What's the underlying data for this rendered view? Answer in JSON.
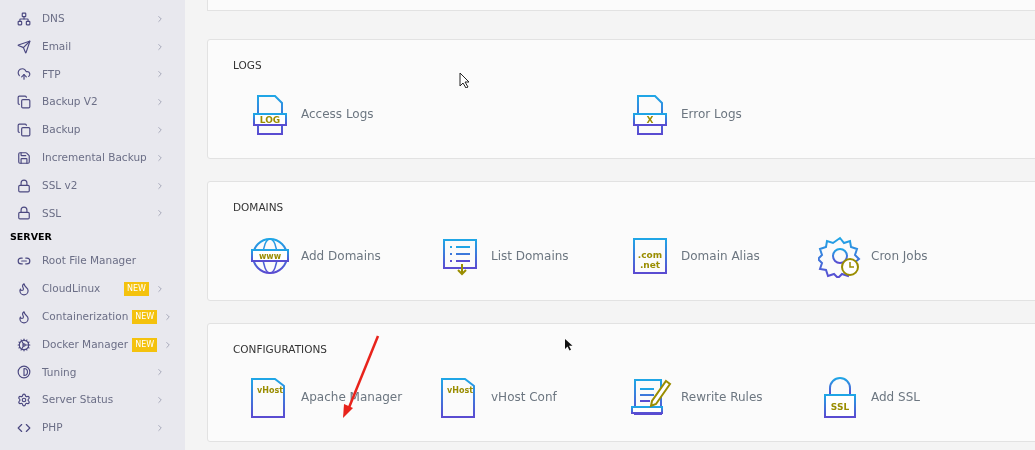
{
  "sidebar": {
    "items": [
      {
        "label": "DNS"
      },
      {
        "label": "Email"
      },
      {
        "label": "FTP"
      },
      {
        "label": "Backup V2"
      },
      {
        "label": "Backup"
      },
      {
        "label": "Incremental Backup"
      },
      {
        "label": "SSL v2"
      },
      {
        "label": "SSL"
      }
    ],
    "section": "SERVER",
    "server_items": [
      {
        "label": "Root File Manager",
        "chevron": false
      },
      {
        "label": "CloudLinux",
        "badge": "NEW",
        "chevron": true
      },
      {
        "label": "Containerization",
        "badge": "NEW",
        "chevron": true
      },
      {
        "label": "Docker Manager",
        "badge": "NEW",
        "chevron": true
      },
      {
        "label": "Tuning",
        "chevron": true
      },
      {
        "label": "Server Status",
        "chevron": true
      },
      {
        "label": "PHP",
        "chevron": true
      }
    ]
  },
  "sections": [
    {
      "title": "LOGS",
      "items": [
        {
          "label": "Access Logs",
          "icon_text": "LOG"
        },
        {
          "label": "Error Logs",
          "icon_text": "X"
        }
      ]
    },
    {
      "title": "DOMAINS",
      "items": [
        {
          "label": "Add Domains",
          "icon_text": "www"
        },
        {
          "label": "List Domains"
        },
        {
          "label": "Domain Alias",
          "icon_text": ".com",
          "icon_text_2": ".net"
        },
        {
          "label": "Cron Jobs"
        }
      ]
    },
    {
      "title": "CONFIGURATIONS",
      "items": [
        {
          "label": "Apache Manager",
          "icon_text": "vHost"
        },
        {
          "label": "vHost Conf",
          "icon_text": "vHost"
        },
        {
          "label": "Rewrite Rules"
        },
        {
          "label": "Add SSL",
          "icon_text": "SSL"
        }
      ]
    }
  ]
}
